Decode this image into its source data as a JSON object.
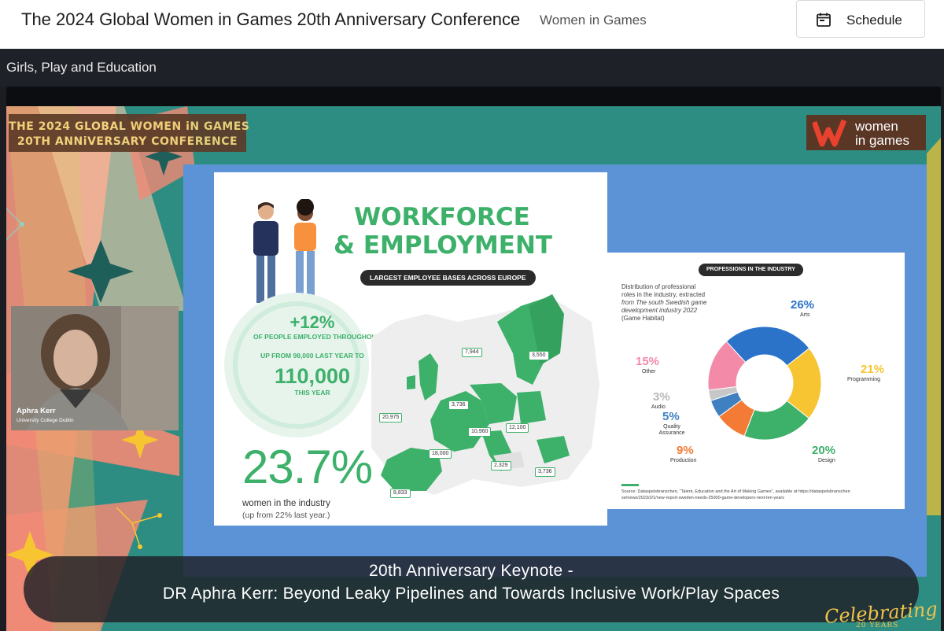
{
  "header": {
    "conference_title": "The 2024 Global Women in Games 20th Anniversary Conference",
    "organizer_link": "Women in Games",
    "schedule_label": "Schedule"
  },
  "session": {
    "title": "Girls, Play and Education"
  },
  "slide": {
    "banner_line1": "THE 2024 GLOBAL WOMEN iN GAMES",
    "banner_line2": "20TH ANNiVERSARY CONFERENCE",
    "logo_line1": "women",
    "logo_line2": "in games",
    "left_card": {
      "title_line1": "WORKFORCE",
      "title_line2": "& EMPLOYMENT",
      "map_pill": "LARGEST EMPLOYEE BASES ACROSS EUROPE",
      "growth_pct": "+12%",
      "growth_desc": "OF PEOPLE EMPLOYED THROUGHOUT EUROPE",
      "up_from": "UP FROM 98,000 LAST YEAR TO",
      "total": "110,000",
      "this_year": "THIS YEAR",
      "women_pct": "23.7%",
      "women_label": "women in the industry",
      "women_prev": "(up from 22% last year.)",
      "map_labels": [
        "7,944",
        "3,550",
        "3,736",
        "20,975",
        "10,960",
        "12,100",
        "18,000",
        "2,329",
        "3,736",
        "8,833"
      ]
    },
    "right_card": {
      "pill": "PROFESSIONS IN THE INDUSTRY",
      "desc_line1": "Distribution of professional",
      "desc_line2": "roles in the industry, extracted",
      "desc_line3": "from The south Swedish game",
      "desc_line4": "development industry 2022",
      "desc_line5": "(Game Habitat)",
      "source_line1": "Source: Dataspelsbranschen, \"Talent, Education and the Art of Making Games\", available at https://dataspelsbranschen",
      "source_line2": "se/news/2023/2/1/new-report-sweden-needs-25000-game-developers-next-ten-years",
      "slices": [
        {
          "pct": "26%",
          "label": "Arts",
          "color": "#2a73c9",
          "value": 26
        },
        {
          "pct": "21%",
          "label": "Programming",
          "color": "#f7c531",
          "value": 21
        },
        {
          "pct": "20%",
          "label": "Design",
          "color": "#3db06a",
          "value": 20
        },
        {
          "pct": "9%",
          "label": "Production",
          "color": "#f47b36",
          "value": 9
        },
        {
          "pct": "5%",
          "label": "Quality Assurance",
          "color": "#3f80c0",
          "value": 5
        },
        {
          "pct": "3%",
          "label": "Audio",
          "color": "#c7c7c7",
          "value": 3
        },
        {
          "pct": "15%",
          "label": "Other",
          "color": "#f28aa8",
          "value": 15
        }
      ]
    },
    "speaker": {
      "name": "Aphra Kerr",
      "affiliation": "University College Dublin"
    },
    "caption_line1": "20th Anniversary Keynote -",
    "caption_line2": "DR Aphra Kerr: Beyond Leaky Pipelines and Towards Inclusive Work/Play Spaces",
    "celebrating": "Celebrating",
    "celebrating_years": "20 YEARS"
  }
}
